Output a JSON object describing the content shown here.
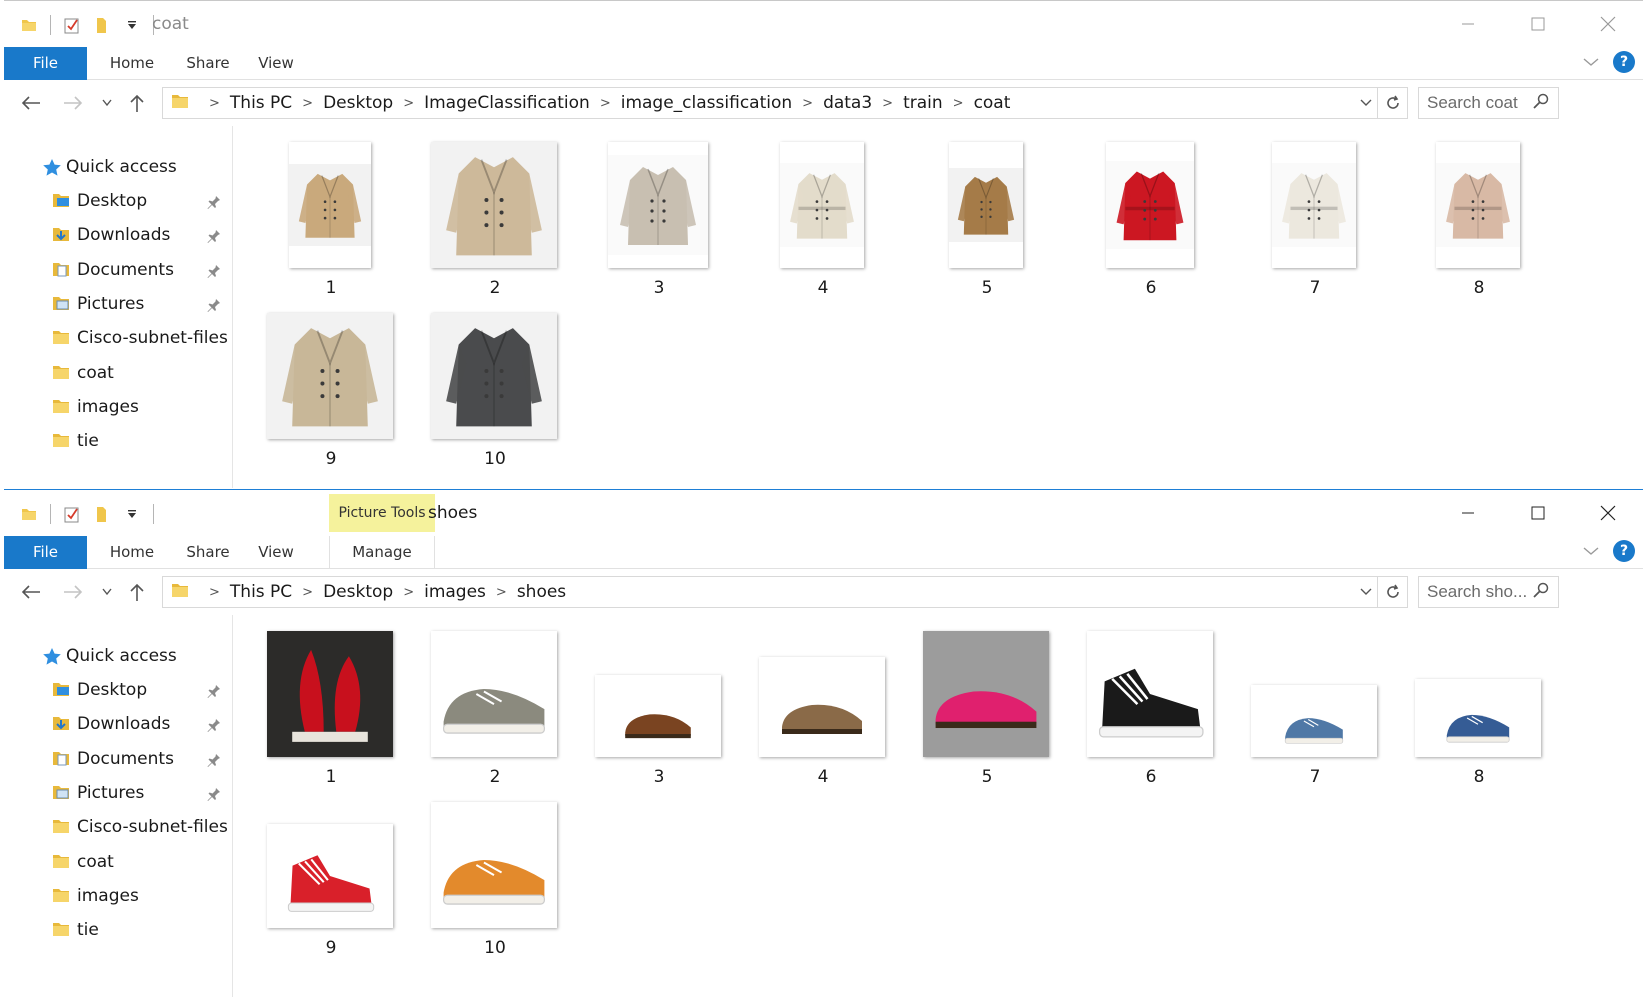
{
  "windows": [
    {
      "id": "coat",
      "title": "coat",
      "context_tab": null,
      "ribbon_tabs": [
        "File",
        "Home",
        "Share",
        "View"
      ],
      "breadcrumb": [
        "This PC",
        "Desktop",
        "ImageClassification",
        "image_classification",
        "data3",
        "train",
        "coat"
      ],
      "search_placeholder": "Search coat",
      "nav": {
        "quick_access": "Quick access",
        "pinned": [
          "Desktop",
          "Downloads",
          "Documents",
          "Pictures"
        ],
        "folders": [
          "Cisco-subnet-files",
          "coat",
          "images",
          "tie"
        ]
      },
      "items": [
        {
          "label": "1",
          "kind": "coat",
          "color": "#c9a97c"
        },
        {
          "label": "2",
          "kind": "coat",
          "color": "#cdb99a"
        },
        {
          "label": "3",
          "kind": "cardigan",
          "color": "#c8bfb1"
        },
        {
          "label": "4",
          "kind": "trench",
          "color": "#e3dccb"
        },
        {
          "label": "5",
          "kind": "coat",
          "color": "#a57b48"
        },
        {
          "label": "6",
          "kind": "trench",
          "color": "#cc1722"
        },
        {
          "label": "7",
          "kind": "trench",
          "color": "#ece8de"
        },
        {
          "label": "8",
          "kind": "dress-coat",
          "color": "#d8b9a5"
        },
        {
          "label": "9",
          "kind": "coat",
          "color": "#c8b798"
        },
        {
          "label": "10",
          "kind": "peacoat",
          "color": "#4a4b4d"
        }
      ]
    },
    {
      "id": "shoes",
      "title": "shoes",
      "context_tab": "Picture Tools",
      "ribbon_tabs": [
        "File",
        "Home",
        "Share",
        "View",
        "Manage"
      ],
      "breadcrumb": [
        "This PC",
        "Desktop",
        "images",
        "shoes"
      ],
      "search_placeholder": "Search sho...",
      "nav": {
        "quick_access": "Quick access",
        "pinned": [
          "Desktop",
          "Downloads",
          "Documents",
          "Pictures"
        ],
        "folders": [
          "Cisco-subnet-files",
          "coat",
          "images",
          "tie"
        ]
      },
      "items": [
        {
          "label": "1",
          "kind": "ballet",
          "color": "#c8101d"
        },
        {
          "label": "2",
          "kind": "sneaker",
          "color": "#8b8a7e"
        },
        {
          "label": "3",
          "kind": "oxford",
          "color": "#7a4421"
        },
        {
          "label": "4",
          "kind": "loafer",
          "color": "#8a6a48"
        },
        {
          "label": "5",
          "kind": "loafer",
          "color": "#e0206e"
        },
        {
          "label": "6",
          "kind": "hightop",
          "color": "#1a1a1a"
        },
        {
          "label": "7",
          "kind": "sneaker",
          "color": "#4f78a6"
        },
        {
          "label": "8",
          "kind": "sneaker",
          "color": "#355c95"
        },
        {
          "label": "9",
          "kind": "hightop",
          "color": "#d9202a"
        },
        {
          "label": "10",
          "kind": "sneaker",
          "color": "#e38a2c"
        }
      ]
    }
  ]
}
